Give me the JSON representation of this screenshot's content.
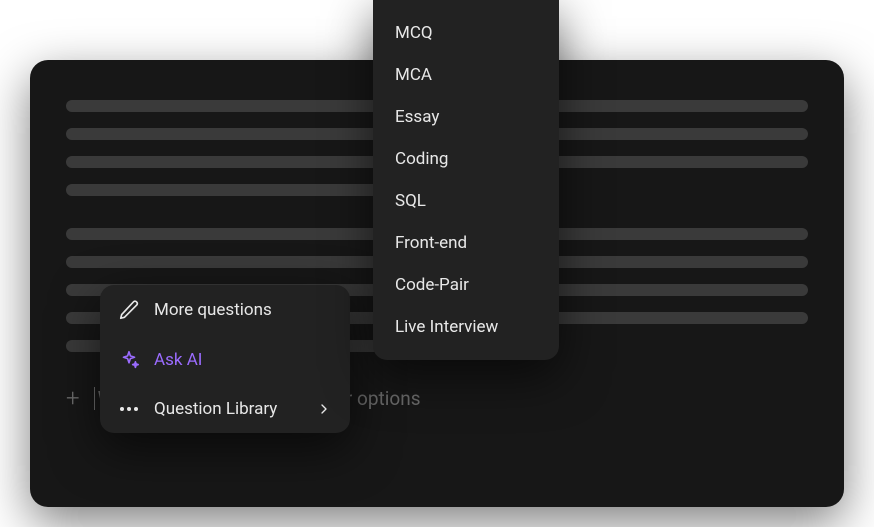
{
  "prompt": {
    "placeholder": "Write something or click '+' for options"
  },
  "popover": {
    "items": [
      {
        "label": "More questions",
        "icon": "pencil"
      },
      {
        "label": "Ask AI",
        "icon": "sparkles"
      },
      {
        "label": "Question Library",
        "icon": "dots",
        "hasSubmenu": true
      }
    ]
  },
  "submenu": {
    "items": [
      "MCQ",
      "MCA",
      "Essay",
      "Coding",
      "SQL",
      "Front-end",
      "Code-Pair",
      "Live Interview"
    ]
  }
}
